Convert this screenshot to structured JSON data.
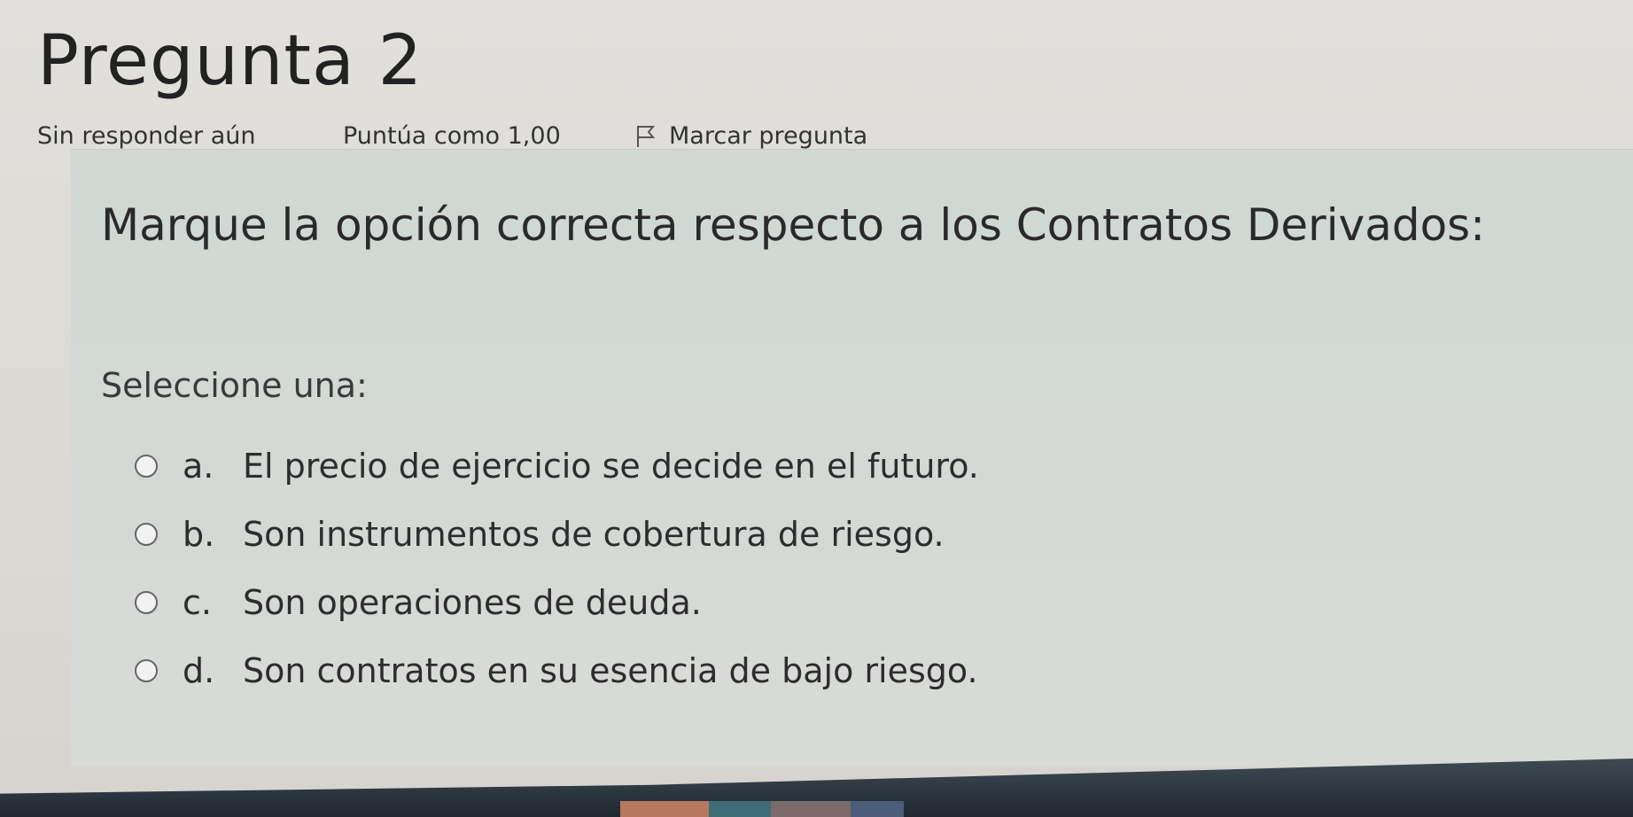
{
  "question": {
    "title": "Pregunta 2",
    "status": "Sin responder aún",
    "score": "Puntúa como 1,00",
    "flag_label": "Marcar pregunta",
    "flag_icon": "flag-icon",
    "text": "Marque la opción correcta respecto a los Contratos Derivados:",
    "prompt": "Seleccione una:",
    "options": [
      {
        "letter": "a.",
        "text": "El precio de ejercicio se decide en el futuro."
      },
      {
        "letter": "b.",
        "text": "Son instrumentos de cobertura de riesgo."
      },
      {
        "letter": "c.",
        "text": "Son operaciones de deuda."
      },
      {
        "letter": "d.",
        "text": "Son contratos en su esencia de bajo riesgo."
      }
    ]
  },
  "colors": {
    "page_background": "#dcd9d4",
    "card_background": "#d2d9d4",
    "text": "#2b2b2b"
  }
}
